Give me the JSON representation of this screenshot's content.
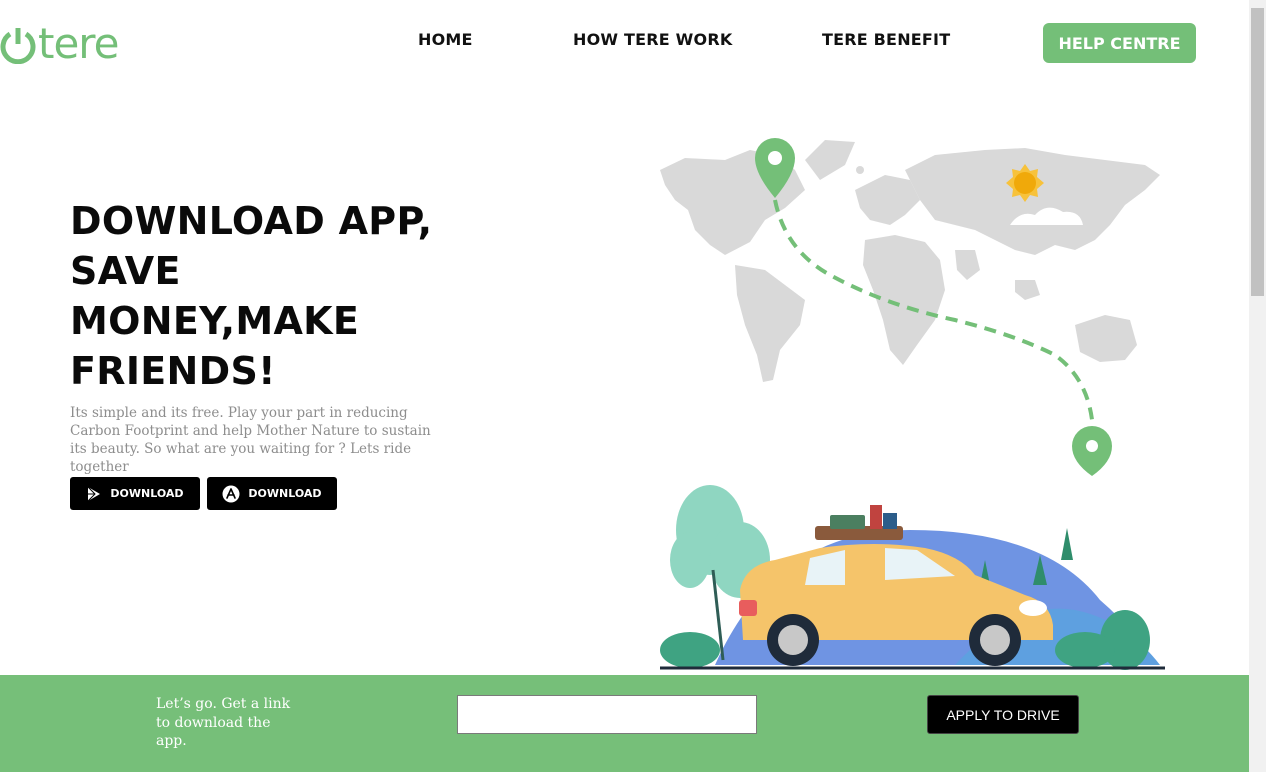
{
  "header": {
    "logo_text": "tere",
    "nav": {
      "home": "HOME",
      "how": "HOW TERE WORK",
      "benefit": "TERE BENEFIT"
    },
    "help_button": "HELP CENTRE"
  },
  "hero": {
    "title_lines": [
      "DOWNLOAD APP,",
      "SAVE",
      "MONEY,MAKE",
      "FRIENDS!"
    ],
    "subtitle": "Its simple and its free. Play your part in reducing Carbon Footprint and help Mother Nature to sustain its beauty. So what are you waiting for ? Lets ride together",
    "download_play": "DOWNLOAD",
    "download_appstore": "DOWNLOAD"
  },
  "cta": {
    "text": "Let’s go. Get a link to download the app.",
    "input_value": "",
    "button": "APPLY TO DRIVE"
  },
  "icons": {
    "play_store": "play-store-icon",
    "app_store": "app-store-icon",
    "logo_power": "power-icon"
  },
  "colors": {
    "brand_green": "#74bf78",
    "cta_bar": "#76bf79",
    "button_black": "#000000",
    "map_gray": "#d9d9d9",
    "car_yellow": "#f5c46a"
  }
}
